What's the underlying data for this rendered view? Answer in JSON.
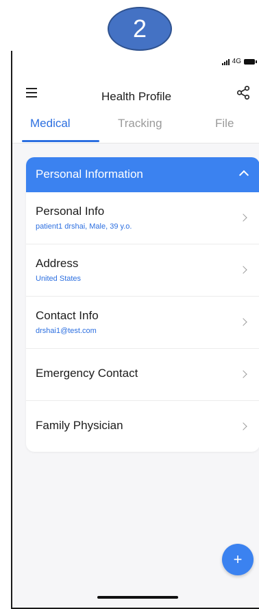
{
  "step_badge": "2",
  "status_bar": {
    "network": "4G"
  },
  "header": {
    "title": "Health Profile"
  },
  "tabs": [
    {
      "label": "Medical"
    },
    {
      "label": "Tracking"
    },
    {
      "label": "File"
    }
  ],
  "section": {
    "title": "Personal Information",
    "items": [
      {
        "title": "Personal Info",
        "subtitle": "patient1 drshai, Male, 39 y.o."
      },
      {
        "title": "Address",
        "subtitle": "United States"
      },
      {
        "title": "Contact Info",
        "subtitle": "drshai1@test.com"
      },
      {
        "title": "Emergency Contact"
      },
      {
        "title": "Family Physician"
      }
    ]
  },
  "fab": {
    "label": "+"
  },
  "colors": {
    "accent": "#3b82f0",
    "tab_active": "#2c6fe0",
    "badge": "#4472c4"
  }
}
